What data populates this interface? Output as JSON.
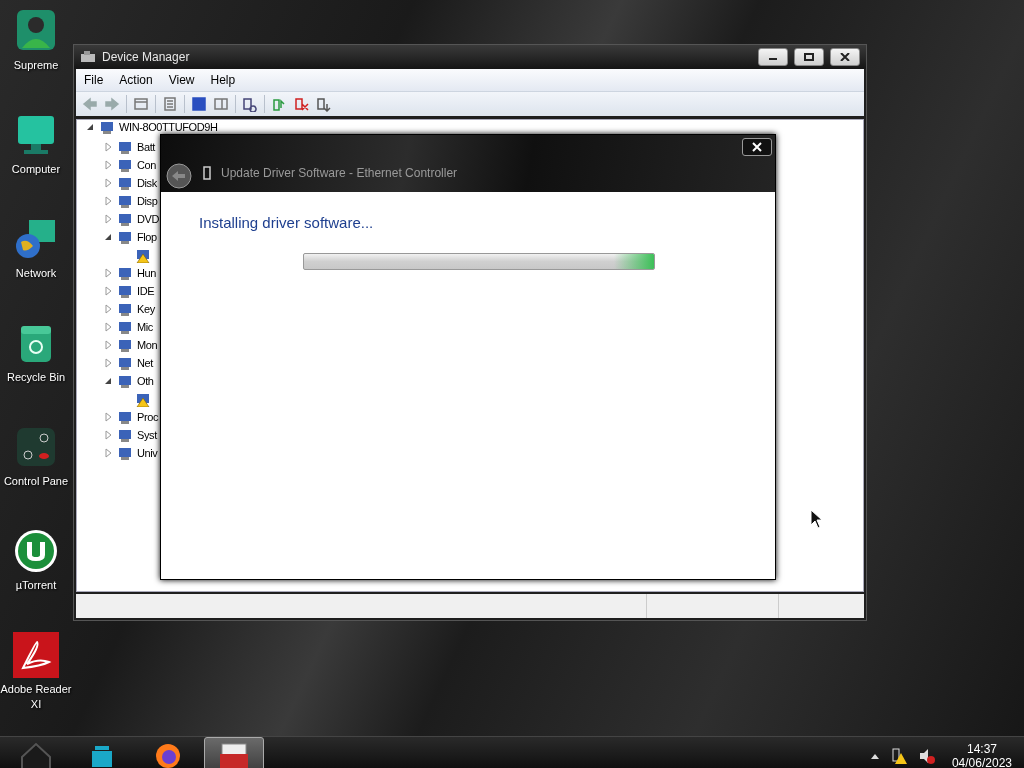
{
  "desktop_icons": [
    {
      "label": "Supreme",
      "kind": "user"
    },
    {
      "label": "Computer",
      "kind": "monitor"
    },
    {
      "label": "Network",
      "kind": "globe"
    },
    {
      "label": "Recycle Bin",
      "kind": "bin"
    },
    {
      "label": "Control Pane",
      "kind": "panel"
    },
    {
      "label": "µTorrent",
      "kind": "torrent"
    },
    {
      "label": "Adobe Reader XI",
      "kind": "pdf"
    }
  ],
  "window": {
    "title": "Device Manager",
    "menu": [
      "File",
      "Action",
      "View",
      "Help"
    ],
    "tree": {
      "label": "WIN-8O0TTUFOD9H",
      "expanded": true,
      "children": [
        {
          "label": "Batt",
          "expanded": false
        },
        {
          "label": "Con",
          "expanded": false
        },
        {
          "label": "Disk",
          "expanded": false
        },
        {
          "label": "Disp",
          "expanded": false
        },
        {
          "label": "DVD",
          "expanded": false
        },
        {
          "label": "Flop",
          "expanded": true,
          "children": [
            {
              "kind": "warning"
            }
          ]
        },
        {
          "label": "Hun",
          "expanded": false
        },
        {
          "label": "IDE",
          "expanded": false
        },
        {
          "label": "Key",
          "expanded": false
        },
        {
          "label": "Mic",
          "expanded": false
        },
        {
          "label": "Mon",
          "expanded": false
        },
        {
          "label": "Net",
          "expanded": false
        },
        {
          "label": "Oth",
          "expanded": true,
          "children": [
            {
              "kind": "warning"
            }
          ]
        },
        {
          "label": "Proc",
          "expanded": false
        },
        {
          "label": "Syst",
          "expanded": false
        },
        {
          "label": "Univ",
          "expanded": false
        }
      ]
    }
  },
  "dialog": {
    "title": "Update Driver Software - Ethernet Controller",
    "heading": "Installing driver software...",
    "progress": {
      "kind": "marquee"
    }
  },
  "taskbar": {
    "apps": [
      {
        "kind": "folder",
        "selected": false
      },
      {
        "kind": "browser",
        "selected": false
      },
      {
        "kind": "toolbox",
        "selected": true
      }
    ],
    "time": "14:37",
    "date": "04/06/2023"
  }
}
